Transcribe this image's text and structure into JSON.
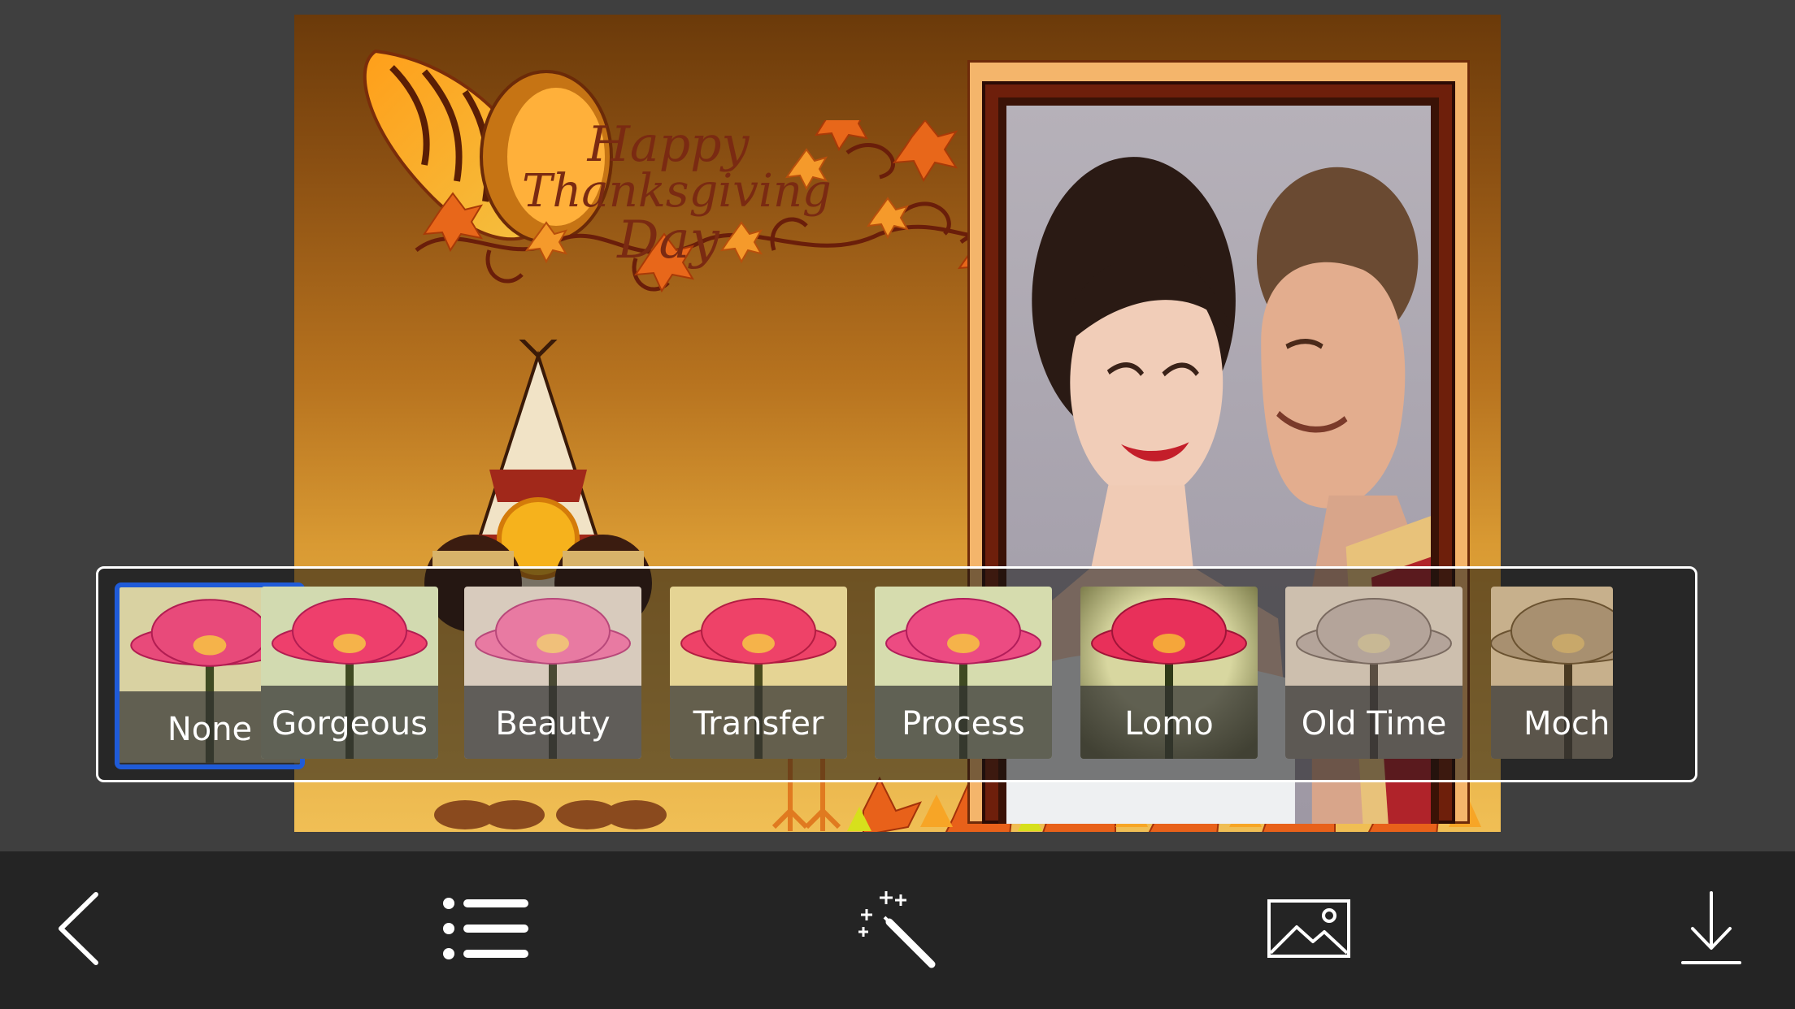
{
  "card": {
    "title_line1": "Happy",
    "title_line2": "Thanksgiving",
    "title_line3": "Day"
  },
  "filters": {
    "selected": "None",
    "items": [
      {
        "label": "None",
        "tint": "normal"
      },
      {
        "label": "Gorgeous",
        "tint": "green"
      },
      {
        "label": "Beauty",
        "tint": "soft"
      },
      {
        "label": "Transfer",
        "tint": "yellow"
      },
      {
        "label": "Process",
        "tint": "green"
      },
      {
        "label": "Lomo",
        "tint": "vignette"
      },
      {
        "label": "Old Time",
        "tint": "sepia"
      },
      {
        "label": "Moch",
        "tint": "mocha"
      }
    ]
  },
  "toolbar": {
    "items": [
      {
        "icon": "chevron-left-icon",
        "action": "back"
      },
      {
        "icon": "list-icon",
        "action": "frames"
      },
      {
        "icon": "magic-wand-icon",
        "action": "effects"
      },
      {
        "icon": "image-icon",
        "action": "gallery"
      },
      {
        "icon": "download-icon",
        "action": "save"
      }
    ]
  },
  "colors": {
    "background": "#3f3f3f",
    "toolbar": "#242424",
    "selection": "#1f5bd8",
    "panel_border": "#ffffff",
    "title_text": "#7a2a12"
  }
}
